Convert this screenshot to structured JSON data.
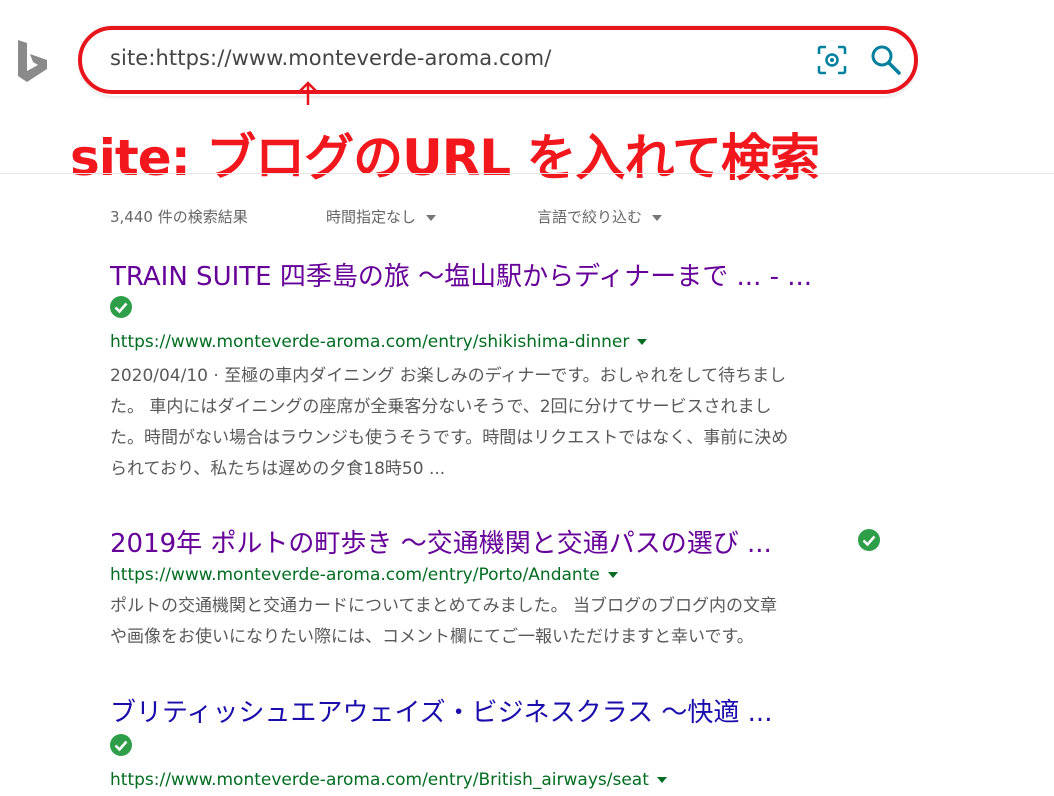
{
  "search": {
    "query": "site:https://www.monteverde-aroma.com/"
  },
  "annotation": {
    "text": "site: ブログのURL を入れて検索",
    "color": "#e8141b"
  },
  "toolbar": {
    "result_count": "3,440 件の検索結果",
    "time_filter": "時間指定なし",
    "language_filter": "言語で絞り込む"
  },
  "results": [
    {
      "title": "TRAIN SUITE 四季島の旅 ～塩山駅からディナーまで ... - ...",
      "url": "https://www.monteverde-aroma.com/entry/shikishima-dinner",
      "snippet": [
        "2020/04/10 · 至極の車内ダイニング お楽しみのディナーです。おしゃれをして待ちまし",
        "た。 車内にはダイニングの座席が全乗客分ないそうで、2回に分けてサービスされまし",
        "た。時間がない場合はラウンジも使うそうです。時間はリクエストではなく、事前に決め",
        "られており、私たちは遅めの夕食18時50 ..."
      ],
      "visited": true
    },
    {
      "title": "2019年 ポルトの町歩き ～交通機関と交通パスの選び ...",
      "url": "https://www.monteverde-aroma.com/entry/Porto/Andante",
      "snippet": [
        "ポルトの交通機関と交通カードについてまとめてみました。 当ブログのブログ内の文章",
        "や画像をお使いになりたい際には、コメント欄にてご一報いただけますと幸いです。"
      ],
      "visited": true
    },
    {
      "title": "ブリティッシュエアウェイズ・ビジネスクラス ～快適 ...",
      "url": "https://www.monteverde-aroma.com/entry/British_airways/seat",
      "snippet": [],
      "visited": false
    }
  ],
  "colors": {
    "visited_title": "#660099",
    "unvisited_title": "#1a0dab",
    "url": "#006d21",
    "verified_check": "#2e9e48",
    "accent": "#00809d"
  },
  "icons": {
    "logo": "bing-logo-icon",
    "visual_search": "visual-search-icon",
    "search": "search-icon",
    "verified": "verified-check-icon"
  }
}
